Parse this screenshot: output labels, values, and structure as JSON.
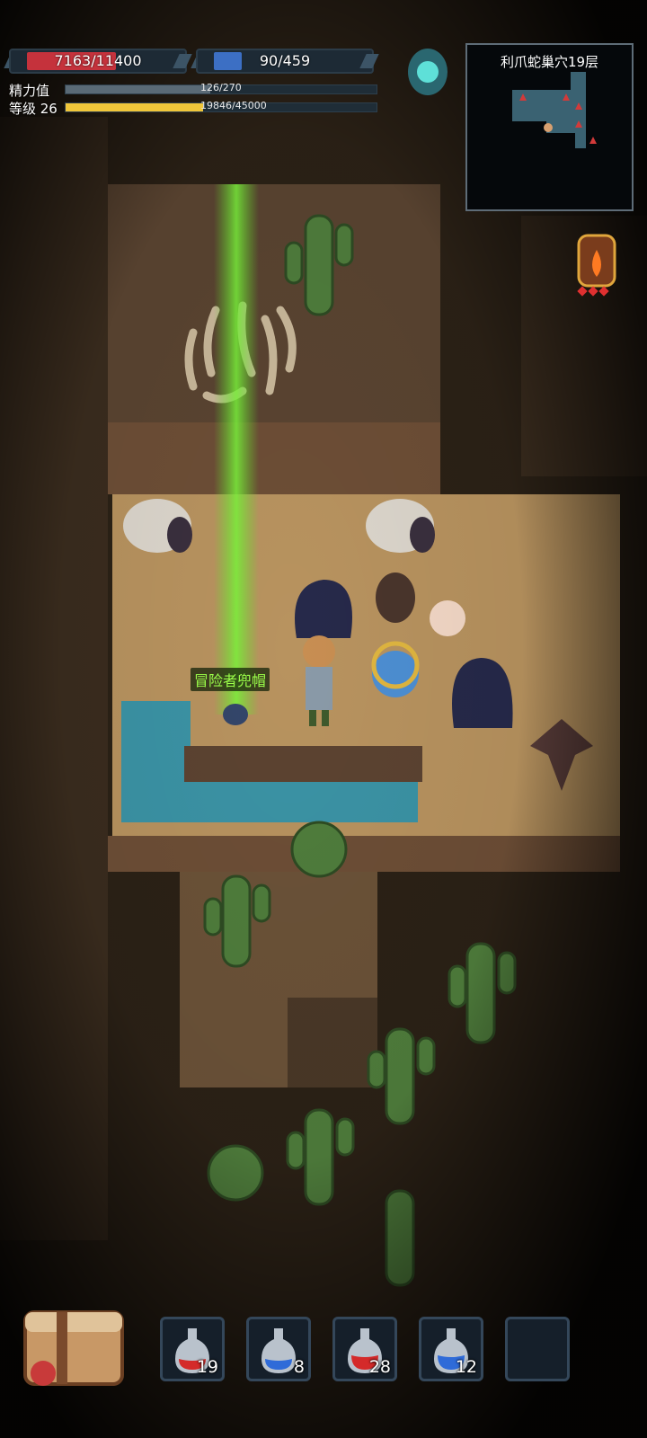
{
  "hud": {
    "hp": {
      "text": "7163/11400",
      "current": 7163,
      "max": 11400,
      "color": "#c5323c"
    },
    "mp": {
      "text": "90/459",
      "current": 90,
      "max": 459,
      "color": "#3c6fc4"
    },
    "stamina": {
      "label": "精力值",
      "text": "126/270",
      "current": 126,
      "max": 270,
      "color": "#5a6a76"
    },
    "level": {
      "label": "等级 26",
      "text": "19846/45000",
      "current": 19846,
      "max": 45000,
      "color": "#f0c63a"
    },
    "portal_icon": "teleport-rune-icon",
    "lantern_icon": "flame-lantern-icon"
  },
  "minimap": {
    "title": "利爪蛇巢穴19层"
  },
  "world": {
    "dropped_item_label": "冒险者兜帽"
  },
  "quickbar": {
    "backpack_icon": "backpack-icon",
    "slots": [
      {
        "icon": "red-potion-icon",
        "count": "19",
        "color": "#d42a2a"
      },
      {
        "icon": "blue-potion-icon",
        "count": "8",
        "color": "#2f6bd8"
      },
      {
        "icon": "red-potion-icon",
        "count": "28",
        "color": "#d42a2a"
      },
      {
        "icon": "blue-potion-icon",
        "count": "12",
        "color": "#2f6bd8"
      },
      {
        "icon": "empty-slot",
        "count": "",
        "color": ""
      }
    ]
  }
}
